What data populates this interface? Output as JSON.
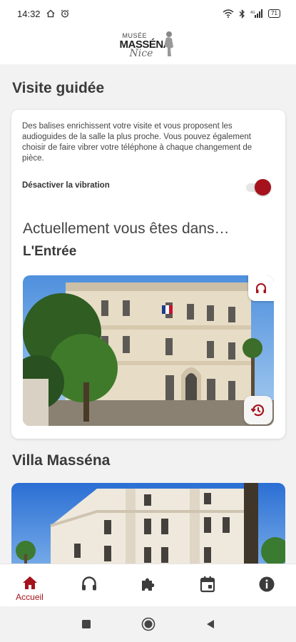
{
  "status_bar": {
    "time": "14:32",
    "battery": "71",
    "signal_label": "4G"
  },
  "header": {
    "logo_line1": "MUSÉE",
    "logo_line2": "MASSÉNA",
    "logo_line3": "Nice"
  },
  "guided_tour": {
    "title": "Visite guidée",
    "description": "Des balises enrichissent votre visite et vous proposent les audioguides de la salle la plus proche. Vous pouvez également choisir de faire vibrer votre téléphone à chaque changement de pièce.",
    "vibration_label": "Désactiver la vibration",
    "vibration_on": true,
    "current_label": "Actuellement vous êtes dans…",
    "current_room": "L'Entrée"
  },
  "villa_section": {
    "title": "Villa Masséna"
  },
  "bottom_nav": {
    "items": [
      {
        "icon": "home-icon",
        "label": "Accueil",
        "active": true
      },
      {
        "icon": "headphones-icon",
        "label": ""
      },
      {
        "icon": "puzzle-icon",
        "label": ""
      },
      {
        "icon": "calendar-icon",
        "label": ""
      },
      {
        "icon": "info-icon",
        "label": ""
      }
    ]
  },
  "colors": {
    "accent": "#a5121c",
    "background": "#f2f2f2",
    "card": "#ffffff"
  }
}
